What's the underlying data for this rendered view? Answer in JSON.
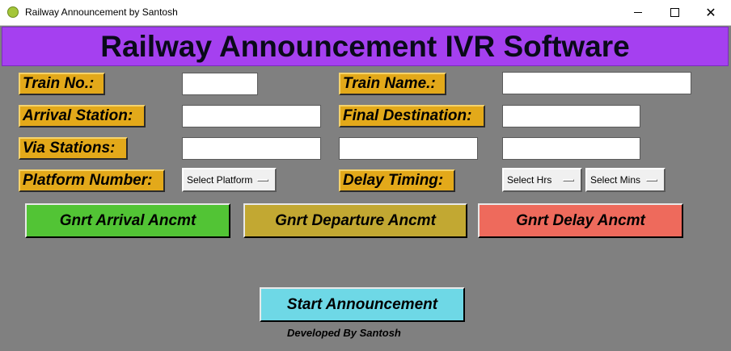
{
  "window": {
    "title": "Railway Announcement by Santosh",
    "minimize": "minimize",
    "maximize": "maximize",
    "close": "✕"
  },
  "header": {
    "title": "Railway Announcement IVR Software"
  },
  "form": {
    "train_no_label": "Train No.:",
    "train_name_label": "Train Name.:",
    "arrival_station_label": "Arrival Station:",
    "final_destination_label": "Final Destination:",
    "via_stations_label": "Via Stations:",
    "platform_number_label": "Platform Number:",
    "delay_timing_label": "Delay Timing:",
    "train_no_value": "",
    "train_name_value": "",
    "arrival_station_value": "",
    "final_destination_value": "",
    "via_station_1_value": "",
    "via_station_2_value": "",
    "via_station_3_value": "",
    "platform_select": "Select Platform",
    "hours_select": "Select Hrs",
    "mins_select": "Select Mins"
  },
  "buttons": {
    "arrival": "Gnrt Arrival Ancmt",
    "departure": "Gnrt Departure Ancmt",
    "delay": "Gnrt Delay Ancmt",
    "start": "Start Announcement"
  },
  "colors": {
    "header_bg": "#a540f0",
    "label_bg": "#e3a91a",
    "arrival_btn": "#52c435",
    "departure_btn": "#c2a832",
    "delay_btn": "#ee6a5c",
    "start_btn": "#6ed8e6",
    "background": "#808080"
  },
  "footer": {
    "credit": "Developed By Santosh"
  }
}
